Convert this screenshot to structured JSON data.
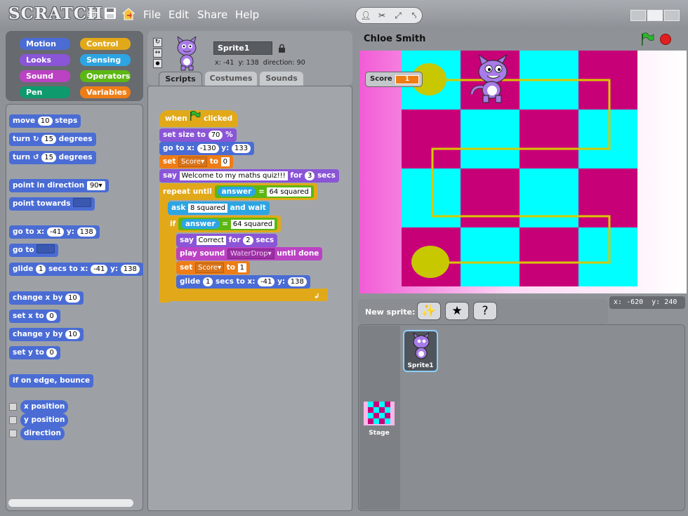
{
  "app": {
    "logo": "SCRATCH"
  },
  "menu": [
    {
      "label": "File"
    },
    {
      "label": "Edit"
    },
    {
      "label": "Share"
    },
    {
      "label": "Help"
    }
  ],
  "categories": [
    {
      "label": "Motion",
      "color": "#4a6cd4"
    },
    {
      "label": "Control",
      "color": "#e1a91a"
    },
    {
      "label": "Looks",
      "color": "#8a55d7"
    },
    {
      "label": "Sensing",
      "color": "#2ca5e2"
    },
    {
      "label": "Sound",
      "color": "#bb42c3"
    },
    {
      "label": "Operators",
      "color": "#5cb712"
    },
    {
      "label": "Pen",
      "color": "#0e9a6c"
    },
    {
      "label": "Variables",
      "color": "#ee7d16"
    }
  ],
  "palette": {
    "move": {
      "pre": "move",
      "val": "10",
      "post": "steps"
    },
    "turn_right": {
      "pre": "turn",
      "val": "15",
      "post": "degrees"
    },
    "turn_left": {
      "pre": "turn",
      "val": "15",
      "post": "degrees"
    },
    "point_direction": {
      "pre": "point in direction",
      "val": "90"
    },
    "point_towards": {
      "pre": "point towards"
    },
    "goto_xy": {
      "pre": "go to x:",
      "x": "-41",
      "mid": "y:",
      "y": "138"
    },
    "goto": {
      "pre": "go to"
    },
    "glide": {
      "pre": "glide",
      "secs": "1",
      "mid1": "secs to x:",
      "x": "-41",
      "mid2": "y:",
      "y": "138"
    },
    "change_x": {
      "pre": "change x by",
      "val": "10"
    },
    "set_x": {
      "pre": "set x to",
      "val": "0"
    },
    "change_y": {
      "pre": "change y by",
      "val": "10"
    },
    "set_y": {
      "pre": "set y to",
      "val": "0"
    },
    "bounce": {
      "label": "if on edge, bounce"
    },
    "reporters": [
      "x position",
      "y position",
      "direction"
    ]
  },
  "sprite": {
    "name": "Sprite1",
    "x_label": "x:",
    "x": "-41",
    "y_label": "y:",
    "y": "138",
    "direction_label": "direction:",
    "direction": "90"
  },
  "tabs": [
    {
      "label": "Scripts",
      "active": true
    },
    {
      "label": "Costumes",
      "active": false
    },
    {
      "label": "Sounds",
      "active": false
    }
  ],
  "script": {
    "hat_pre": "when",
    "hat_post": "clicked",
    "size_pre": "set size to",
    "size_val": "70",
    "size_post": "%",
    "goto_pre": "go to x:",
    "goto_x": "-130",
    "goto_mid": "y:",
    "goto_y": "133",
    "setvar_pre": "set",
    "setvar_name": "Score",
    "setvar_mid": "to",
    "setvar_val": "0",
    "say_pre": "say",
    "say_text": "Welcome to my maths quiz!!!",
    "say_mid": "for",
    "say_secs": "3",
    "say_post": "secs",
    "repeat_pre": "repeat until",
    "cond_left": "answer",
    "cond_op": "=",
    "cond_right": "64 squared",
    "ask_pre": "ask",
    "ask_text": "8 squared",
    "ask_post": "and wait",
    "if_pre": "if",
    "if_left": "answer",
    "if_op": "=",
    "if_right": "64 squared",
    "say2_pre": "say",
    "say2_text": "Correct",
    "say2_mid": "for",
    "say2_secs": "2",
    "say2_post": "secs",
    "sound_pre": "play sound",
    "sound_name": "WaterDrop",
    "sound_post": "until done",
    "set2_pre": "set",
    "set2_name": "Score",
    "set2_mid": "to",
    "set2_val": "1",
    "glide_pre": "glide",
    "glide_secs": "1",
    "glide_mid1": "secs to x:",
    "glide_x": "-41",
    "glide_mid2": "y:",
    "glide_y": "138"
  },
  "stage": {
    "project_title": "Chloe Smith",
    "score_label": "Score",
    "score_value": "1",
    "mouse_x_label": "x:",
    "mouse_x": "-620",
    "mouse_y_label": "y:",
    "mouse_y": "240"
  },
  "corral": {
    "new_sprite_label": "New sprite:",
    "sprite_label": "Sprite1",
    "stage_label": "Stage"
  }
}
